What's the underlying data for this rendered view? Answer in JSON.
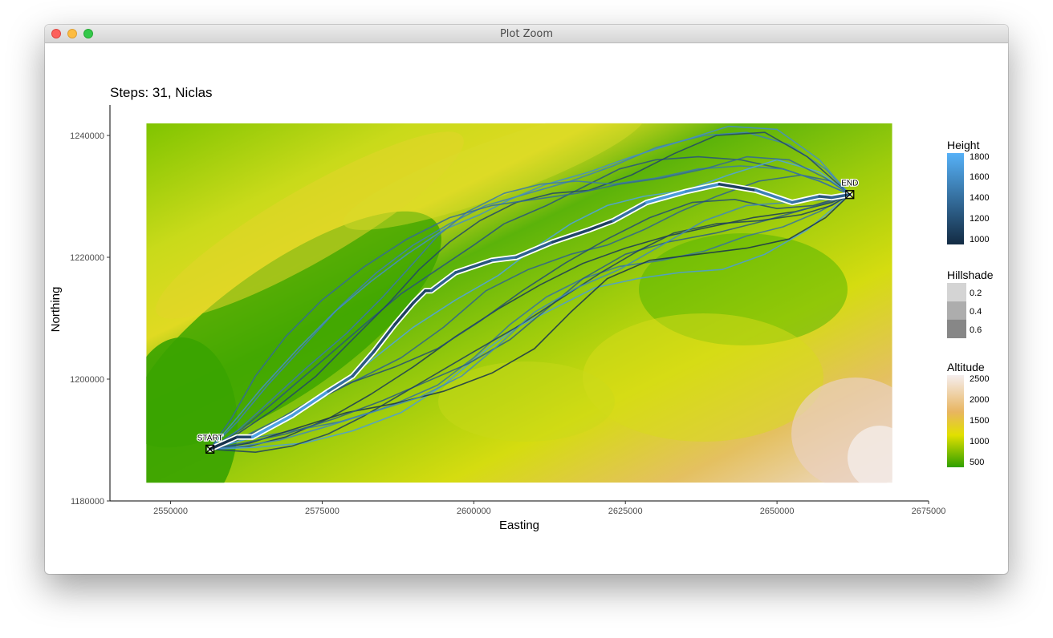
{
  "window": {
    "title": "Plot Zoom"
  },
  "colors": {
    "terrain_low": "#3ca300",
    "terrain_mid": "#dbe000",
    "terrain_high": "#e8b070",
    "terrain_peak": "#f3e6e2",
    "route_highlight": "#4b9fe0",
    "route_casing": "#ffffff",
    "trial_path_dark": "#1c3a5a",
    "trial_path_light": "#3f7ec0"
  },
  "chart_data": {
    "type": "line",
    "title": "Steps: 31, Niclas",
    "xlabel": "Easting",
    "ylabel": "Northing",
    "xlim": [
      2540000,
      2675000
    ],
    "ylim": [
      1180000,
      1245000
    ],
    "xticks": [
      2550000,
      2575000,
      2600000,
      2625000,
      2650000,
      2675000
    ],
    "yticks": [
      1180000,
      1200000,
      1220000,
      1240000
    ],
    "grid": false,
    "terrain_extent": {
      "x": [
        2546000,
        2669000
      ],
      "y": [
        1183000,
        1242000
      ]
    },
    "markers": [
      {
        "label": "START",
        "x": 2556500,
        "y": 1188500
      },
      {
        "label": "END",
        "x": 2662000,
        "y": 1230300
      }
    ],
    "route": {
      "x": [
        2556500,
        2561000,
        2563500,
        2570000,
        2576000,
        2580000,
        2583500,
        2587000,
        2590000,
        2592000,
        2593000,
        2597000,
        2603000,
        2607000,
        2613000,
        2619000,
        2623000,
        2628500,
        2635000,
        2640500,
        2646500,
        2652500,
        2657000,
        2659000,
        2662000
      ],
      "y": [
        1188500,
        1190500,
        1190500,
        1194000,
        1198000,
        1200500,
        1204500,
        1209000,
        1212500,
        1214500,
        1214500,
        1217500,
        1219500,
        1220000,
        1222500,
        1224500,
        1226000,
        1229000,
        1230800,
        1232000,
        1231000,
        1229000,
        1230000,
        1229800,
        1230300
      ],
      "height": [
        950,
        1100,
        1750,
        1700,
        1400,
        1250,
        1150,
        1050,
        1100,
        1050,
        1300,
        1200,
        1400,
        1300,
        1100,
        1050,
        1400,
        1700,
        1600,
        1050,
        1500,
        1400,
        1200,
        1300,
        1250
      ]
    },
    "trials": [
      {
        "height": 1200,
        "x": [
          2556500,
          2562000,
          2568000,
          2575000,
          2582000,
          2588000,
          2594000,
          2600000,
          2605000,
          2612000,
          2618000,
          2624000,
          2630000,
          2637000,
          2644000,
          2651000,
          2657000,
          2662000
        ],
        "y": [
          1188500,
          1192000,
          1197000,
          1203000,
          1209000,
          1214000,
          1218000,
          1222000,
          1225500,
          1228500,
          1231500,
          1234500,
          1236000,
          1236500,
          1236000,
          1234500,
          1232500,
          1230300
        ]
      },
      {
        "height": 1500,
        "x": [
          2556500,
          2561000,
          2566000,
          2572000,
          2578000,
          2584000,
          2590000,
          2596000,
          2602000,
          2609000,
          2616000,
          2623000,
          2630000,
          2638000,
          2645000,
          2652000,
          2658000,
          2662000
        ],
        "y": [
          1188500,
          1193000,
          1199000,
          1205500,
          1212000,
          1217500,
          1222000,
          1225500,
          1228500,
          1230500,
          1232500,
          1235000,
          1238000,
          1240000,
          1240500,
          1238500,
          1234500,
          1230300
        ]
      },
      {
        "height": 1000,
        "x": [
          2556500,
          2563000,
          2569000,
          2576000,
          2583000,
          2590000,
          2597000,
          2604000,
          2611000,
          2618000,
          2625000,
          2632000,
          2639000,
          2646000,
          2653000,
          2659000,
          2662000
        ],
        "y": [
          1188500,
          1189000,
          1190500,
          1193500,
          1197500,
          1202000,
          1207000,
          1211500,
          1215500,
          1219000,
          1221500,
          1223500,
          1225000,
          1226500,
          1227500,
          1229000,
          1230300
        ]
      },
      {
        "height": 1400,
        "x": [
          2556500,
          2562000,
          2570000,
          2578000,
          2586000,
          2594000,
          2600000,
          2606000,
          2612000,
          2618000,
          2624000,
          2631000,
          2638000,
          2645000,
          2651000,
          2657000,
          2662000
        ],
        "y": [
          1188500,
          1190000,
          1191500,
          1193000,
          1195500,
          1199000,
          1203500,
          1209000,
          1213500,
          1216500,
          1218500,
          1219500,
          1221000,
          1223500,
          1225000,
          1227500,
          1230300
        ]
      },
      {
        "height": 1100,
        "x": [
          2556500,
          2561000,
          2567000,
          2574000,
          2580000,
          2586000,
          2591000,
          2596000,
          2601000,
          2607000,
          2613000,
          2619000,
          2626000,
          2633000,
          2640000,
          2648000,
          2655000,
          2662000
        ],
        "y": [
          1188500,
          1191000,
          1195000,
          1200500,
          1206500,
          1212500,
          1218000,
          1222500,
          1226000,
          1229000,
          1230500,
          1231000,
          1233500,
          1237000,
          1240000,
          1240500,
          1236500,
          1230300
        ]
      },
      {
        "height": 1700,
        "x": [
          2556500,
          2564000,
          2572000,
          2580000,
          2588000,
          2595000,
          2601000,
          2607000,
          2614000,
          2620000,
          2627000,
          2634000,
          2641000,
          2648000,
          2655000,
          2662000
        ],
        "y": [
          1188500,
          1188800,
          1189500,
          1191500,
          1194500,
          1199000,
          1204000,
          1208500,
          1212000,
          1215000,
          1216500,
          1217500,
          1218000,
          1220500,
          1224500,
          1230300
        ]
      },
      {
        "height": 1300,
        "x": [
          2556500,
          2562000,
          2568000,
          2574000,
          2581000,
          2588000,
          2595000,
          2602000,
          2609000,
          2616000,
          2622000,
          2628000,
          2634000,
          2640000,
          2647000,
          2654000,
          2659000,
          2662000
        ],
        "y": [
          1188500,
          1190500,
          1193500,
          1197000,
          1200000,
          1203500,
          1208500,
          1214500,
          1218000,
          1220500,
          1222000,
          1224500,
          1227500,
          1230000,
          1232500,
          1233500,
          1232500,
          1230300
        ]
      },
      {
        "height": 1600,
        "x": [
          2556500,
          2560000,
          2565000,
          2571000,
          2577000,
          2583000,
          2589000,
          2595000,
          2601000,
          2606000,
          2612000,
          2619000,
          2626000,
          2634000,
          2642000,
          2650000,
          2657000,
          2662000
        ],
        "y": [
          1188500,
          1192500,
          1198500,
          1205000,
          1211000,
          1216000,
          1220500,
          1224500,
          1227000,
          1229500,
          1232000,
          1234000,
          1236500,
          1239000,
          1241500,
          1241000,
          1236000,
          1230300
        ]
      },
      {
        "height": 950,
        "x": [
          2556500,
          2563000,
          2571000,
          2579000,
          2587000,
          2595000,
          2603000,
          2610000,
          2616000,
          2622000,
          2629000,
          2637000,
          2645000,
          2652000,
          2658000,
          2662000
        ],
        "y": [
          1188500,
          1189500,
          1192000,
          1194500,
          1196000,
          1198000,
          1201000,
          1205000,
          1211000,
          1216500,
          1219500,
          1220500,
          1221500,
          1223000,
          1226500,
          1230300
        ]
      },
      {
        "height": 1250,
        "x": [
          2556500,
          2562000,
          2569000,
          2577000,
          2585000,
          2592000,
          2599000,
          2606000,
          2612000,
          2618000,
          2625000,
          2632000,
          2640000,
          2648000,
          2655000,
          2660000,
          2662000
        ],
        "y": [
          1188500,
          1189500,
          1191000,
          1193500,
          1196500,
          1199500,
          1202500,
          1206500,
          1211500,
          1216500,
          1220500,
          1222500,
          1224000,
          1226000,
          1228000,
          1229500,
          1230300
        ]
      },
      {
        "height": 1450,
        "x": [
          2556500,
          2561000,
          2566000,
          2572000,
          2579000,
          2585000,
          2590000,
          2594000,
          2599000,
          2605000,
          2611000,
          2617000,
          2623000,
          2630000,
          2637000,
          2644000,
          2651000,
          2657000,
          2662000
        ],
        "y": [
          1188500,
          1191500,
          1196000,
          1201500,
          1207500,
          1213500,
          1219000,
          1223500,
          1227500,
          1230500,
          1232000,
          1232500,
          1232000,
          1233000,
          1234500,
          1235000,
          1234500,
          1232500,
          1230300
        ]
      },
      {
        "height": 1050,
        "x": [
          2556500,
          2564000,
          2570000,
          2576000,
          2582000,
          2588000,
          2594000,
          2600000,
          2607000,
          2614000,
          2621000,
          2627000,
          2633000,
          2640000,
          2647000,
          2654000,
          2659000,
          2662000
        ],
        "y": [
          1188500,
          1188000,
          1189000,
          1191000,
          1194000,
          1197500,
          1201000,
          1204500,
          1208500,
          1213000,
          1217500,
          1221000,
          1224000,
          1225500,
          1226000,
          1227000,
          1228500,
          1230300
        ]
      },
      {
        "height": 1750,
        "x": [
          2556500,
          2562000,
          2569000,
          2576000,
          2583000,
          2590000,
          2597000,
          2604000,
          2610000,
          2616000,
          2622000,
          2628000,
          2635000,
          2642000,
          2650000,
          2657000,
          2662000
        ],
        "y": [
          1188500,
          1190000,
          1193000,
          1197500,
          1203000,
          1208500,
          1213000,
          1217000,
          1221500,
          1225500,
          1228500,
          1230000,
          1231000,
          1233500,
          1236000,
          1234000,
          1230300
        ]
      },
      {
        "height": 1150,
        "x": [
          2556500,
          2561000,
          2567000,
          2573000,
          2580000,
          2587000,
          2594000,
          2601000,
          2608000,
          2615000,
          2622000,
          2629000,
          2636000,
          2643000,
          2650000,
          2656000,
          2662000
        ],
        "y": [
          1188500,
          1190000,
          1192500,
          1196000,
          1199500,
          1202000,
          1205000,
          1209500,
          1214500,
          1219000,
          1223000,
          1226500,
          1229000,
          1229500,
          1228000,
          1228500,
          1230300
        ]
      },
      {
        "height": 1350,
        "x": [
          2556500,
          2560000,
          2564000,
          2569000,
          2575000,
          2582000,
          2589000,
          2596000,
          2603000,
          2610000,
          2617000,
          2624000,
          2631000,
          2638000,
          2645000,
          2652000,
          2658000,
          2662000
        ],
        "y": [
          1188500,
          1193500,
          1200500,
          1207000,
          1213000,
          1218500,
          1223000,
          1226500,
          1228500,
          1229500,
          1230500,
          1232000,
          1233000,
          1234500,
          1236500,
          1236000,
          1233000,
          1230300
        ]
      },
      {
        "height": 1550,
        "x": [
          2556500,
          2562000,
          2568000,
          2575000,
          2583000,
          2591000,
          2598000,
          2604000,
          2610000,
          2617000,
          2624000,
          2631000,
          2638000,
          2645000,
          2652000,
          2658000,
          2662000
        ],
        "y": [
          1188500,
          1189000,
          1190000,
          1192000,
          1194500,
          1197000,
          1200500,
          1205500,
          1211000,
          1215000,
          1218000,
          1222000,
          1226000,
          1228500,
          1229000,
          1229500,
          1230300
        ]
      }
    ],
    "legends": [
      {
        "title": "Height",
        "labels": [
          "1800",
          "1600",
          "1400",
          "1200",
          "1000"
        ]
      },
      {
        "title": "Hillshade",
        "labels": [
          "0.2",
          "0.4",
          "0.6"
        ]
      },
      {
        "title": "Altitude",
        "labels": [
          "2500",
          "2000",
          "1500",
          "1000",
          "500"
        ]
      }
    ]
  }
}
